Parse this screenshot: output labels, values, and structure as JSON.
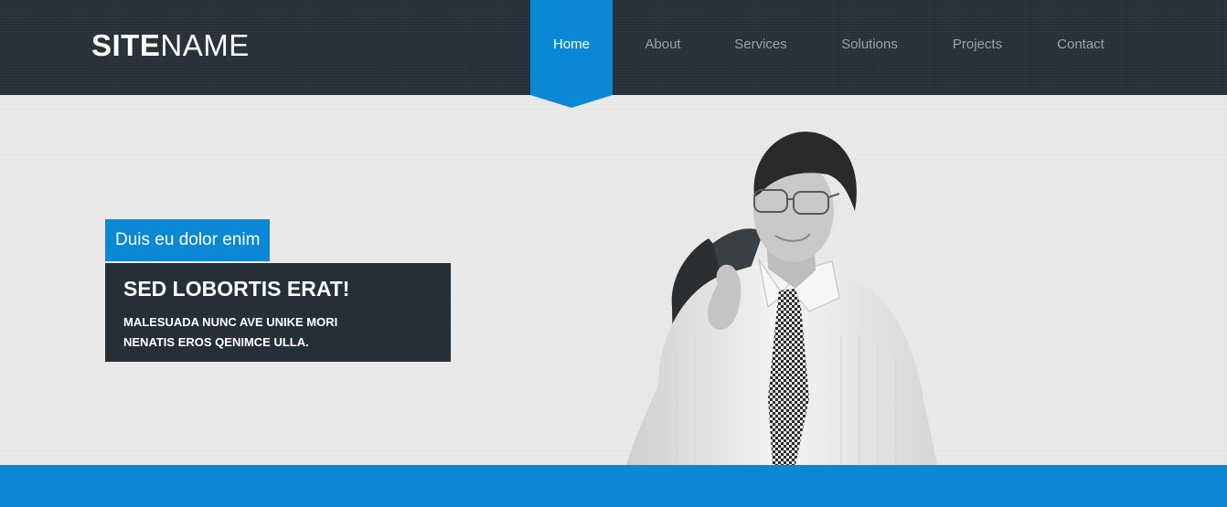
{
  "header": {
    "logo_bold": "SITE",
    "logo_light": "NAME"
  },
  "nav": {
    "items": [
      {
        "label": "Home",
        "active": true
      },
      {
        "label": "About",
        "active": false
      },
      {
        "label": "Services",
        "active": false
      },
      {
        "label": "Solutions",
        "active": false
      },
      {
        "label": "Projects",
        "active": false
      },
      {
        "label": "Contact",
        "active": false
      }
    ]
  },
  "hero": {
    "tag": "Duis eu dolor enim",
    "title": "SED LOBORTIS ERAT!",
    "text": "MALESUADA NUNC AVE UNIKE MORI NENATIS EROS QENIMCE ULLA."
  },
  "colors": {
    "accent": "#0a88d6",
    "dark": "#262e37",
    "background": "#ebebeb"
  }
}
